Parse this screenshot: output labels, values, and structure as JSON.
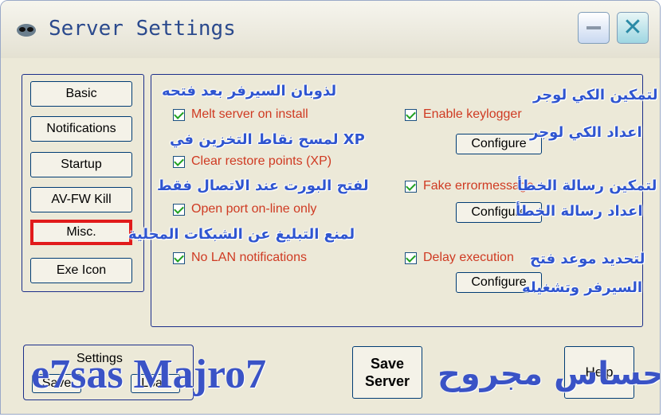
{
  "window": {
    "title": "Server Settings",
    "app_icon": "alien-icon"
  },
  "nav": {
    "items": [
      "Basic",
      "Notifications",
      "Startup",
      "AV-FW Kill",
      "Misc.",
      "Exe Icon"
    ],
    "active": "Misc."
  },
  "options": {
    "melt_server": "Melt server on install",
    "clear_restore": "Clear restore points (XP)",
    "open_port": "Open port on-line only",
    "no_lan": "No LAN notifications",
    "keylogger": "Enable keylogger",
    "fake_error": "Fake errormessage",
    "delay_execution": "Delay execution",
    "configure": "Configure"
  },
  "annotations": {
    "melt": "لذوبان السيرفر بعد فتحه",
    "restore": "لمسح نقاط التخزين في XP",
    "port": "لفتح البورت عند الاتصال فقط",
    "lan": "لمنع التبليغ عن الشبكات المحلية",
    "keylogger_enable": "لتمكين الكي لوجر",
    "keylogger_config": "اعداد الكي لوجر",
    "error_enable": "لتمكين رسالة الخطأ",
    "error_config": "اعداد رسالة الخطأ",
    "delay_1": "لتحديد موعد فتح",
    "delay_2": "السيرفر وتشغيله"
  },
  "footer": {
    "settings_label": "Settings",
    "save": "Save",
    "load": "Load",
    "save_server_line1": "Save",
    "save_server_line2": "Server",
    "help": "Help"
  },
  "watermark": {
    "latin": "e7sas Majro7",
    "arabic": "احساس مجروح"
  },
  "colors": {
    "annotation": "#2f55d0",
    "checkbox_label": "#cf3a22",
    "active_highlight": "#e11b1b"
  }
}
